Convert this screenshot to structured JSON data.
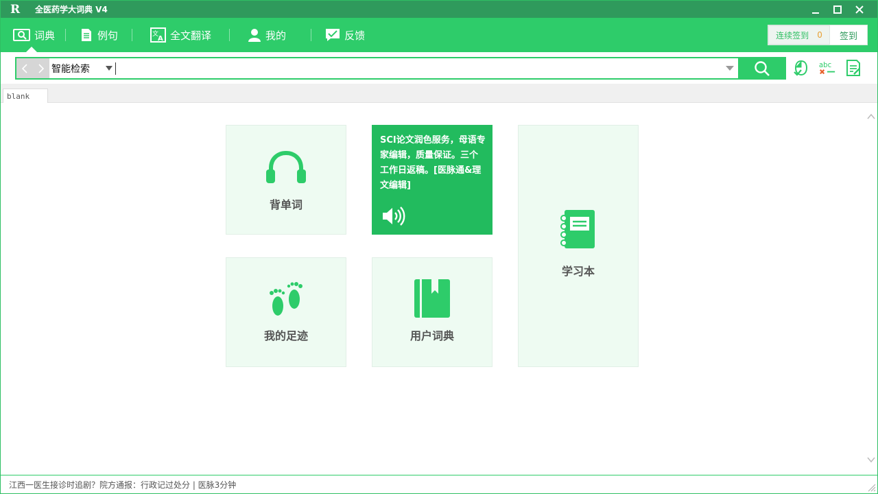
{
  "window": {
    "logo_text": "R",
    "title": "全医药学大词典  V4"
  },
  "nav": {
    "items": [
      {
        "label": "词典",
        "icon": "dictionary-icon"
      },
      {
        "label": "例句",
        "icon": "document-icon"
      },
      {
        "label": "全文翻译",
        "icon": "translate-icon"
      },
      {
        "label": "我的",
        "icon": "user-icon"
      },
      {
        "label": "反馈",
        "icon": "feedback-icon"
      }
    ],
    "signin": {
      "streak_label": "连续签到",
      "streak_count": "0",
      "button_label": "签到"
    }
  },
  "search": {
    "mode": "智能检索",
    "query": ""
  },
  "tabs": [
    {
      "label": "blank"
    }
  ],
  "cards": {
    "vocab": {
      "label": "背单词",
      "icon": "headphones-icon"
    },
    "ad": {
      "text": "SCI论文润色服务，母语专家编辑，质量保证。三个工作日返稿。[医脉通&理文编辑]",
      "icon": "speaker-icon"
    },
    "notebook": {
      "label": "学习本",
      "icon": "notebook-icon"
    },
    "history": {
      "label": "我的足迹",
      "icon": "footprints-icon"
    },
    "userdict": {
      "label": "用户词典",
      "icon": "book-icon"
    }
  },
  "status": {
    "text": "江西一医生接诊时追剧？院方通报：行政记过处分 | 医脉3分钟"
  },
  "colors": {
    "brand": "#2ecc6a",
    "title_bar": "#2f9a5c",
    "card_bg": "#eefbf2",
    "ad_bg": "#22bb5e",
    "accent_orange": "#e8a033"
  }
}
